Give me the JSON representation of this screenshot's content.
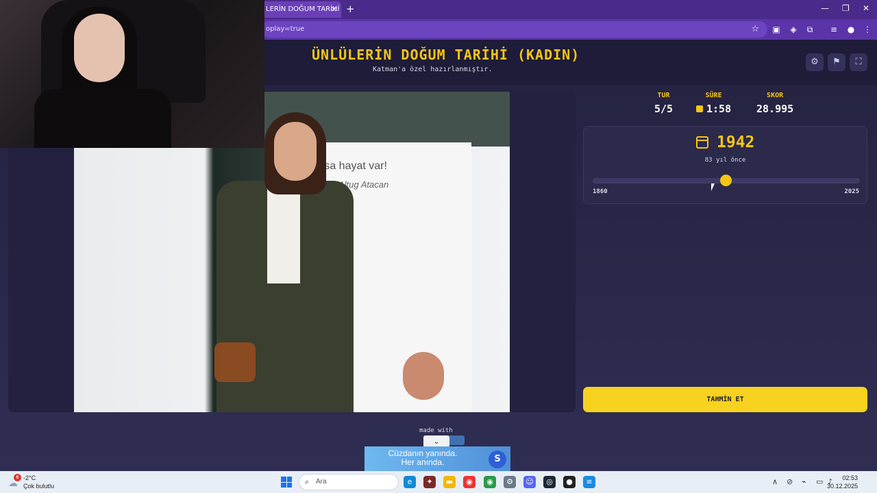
{
  "browser": {
    "tab_title": "LERİN DOĞUM TARİHİ (K...",
    "tab_close": "✕",
    "new_tab": "+",
    "url": "oplay=true",
    "win_min": "—",
    "win_restore": "❐",
    "win_close": "✕"
  },
  "game": {
    "title": "ÜNLÜLERİN DOĞUM TARİHİ (KADIN)",
    "subtitle": "Katman'a özel hazırlanmıştır.",
    "buttons": {
      "settings": "⚙",
      "flag": "⚑",
      "fullscreen": "⛶"
    }
  },
  "photo": {
    "banner_text": "rsa hayat var!",
    "banner_name": "Altug Atacan"
  },
  "stats": {
    "round_label": "TUR",
    "round_value": "5/5",
    "time_label": "SÜRE",
    "time_value": "1:58",
    "score_label": "SKOR",
    "score_value": "28.995"
  },
  "guess": {
    "year": "1942",
    "years_ago": "83 yıl önce",
    "slider_min": "1860",
    "slider_max": "2025",
    "slider_value": 1942,
    "slider_min_value": 1860,
    "slider_max_value": 2025
  },
  "submit_label": "TAHMİN ET",
  "footer": {
    "made_with": "made with",
    "ad_collapse": "⌄",
    "ad_line1": "Cüzdanın yanında.",
    "ad_line2": "Her anında.",
    "ad_logo": "S"
  },
  "taskbar": {
    "weather_badge": "6",
    "weather_temp": "-2°C",
    "weather_desc": "Çok bulutlu",
    "search_placeholder": "Ara",
    "time": "02:53",
    "date": "30.12.2025"
  },
  "colors": {
    "accent": "#f5c518",
    "button": "#f7d21e",
    "bg": "#2b2a4a"
  }
}
